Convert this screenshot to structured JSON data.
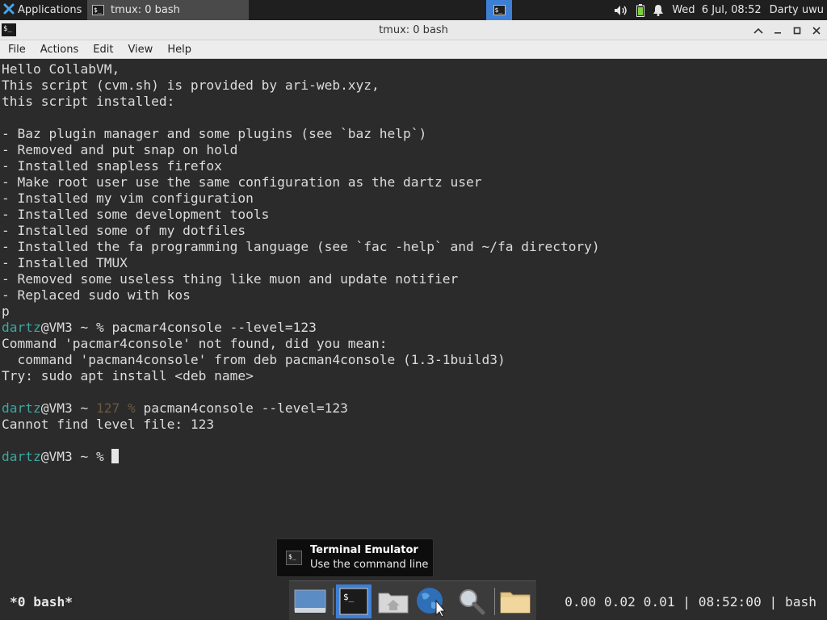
{
  "top_panel": {
    "apps_label": "Applications",
    "task_label": "tmux: 0 bash",
    "clock": "Wed  6 Jul, 08:52",
    "user": "Darty uwu"
  },
  "window": {
    "title": "tmux: 0 bash"
  },
  "menubar": {
    "items": [
      "File",
      "Actions",
      "Edit",
      "View",
      "Help"
    ]
  },
  "terminal": {
    "lines": [
      "Hello CollabVM,",
      "This script (cvm.sh) is provided by ari-web.xyz,",
      "this script installed:",
      "",
      "- Baz plugin manager and some plugins (see `baz help`)",
      "- Removed and put snap on hold",
      "- Installed snapless firefox",
      "- Make root user use the same configuration as the dartz user",
      "- Installed my vim configuration",
      "- Installed some development tools",
      "- Installed some of my dotfiles",
      "- Installed the fa programming language (see `fac -help` and ~/fa directory)",
      "- Installed TMUX",
      "- Removed some useless thing like muon and update notifier",
      "- Replaced sudo with kos",
      "p"
    ],
    "prompt1": {
      "user": "dartz",
      "host": "@VM3 ~ % ",
      "command": "pacmar4console --level=123"
    },
    "output1": [
      "Command 'pacmar4console' not found, did you mean:",
      "  command 'pacman4console' from deb pacman4console (1.3-1build3)",
      "Try: sudo apt install <deb name>",
      ""
    ],
    "prompt2": {
      "user": "dartz",
      "host": "@VM3 ~ ",
      "status": "127 % ",
      "command": "pacman4console --level=123"
    },
    "output2": [
      "Cannot find level file: 123",
      ""
    ],
    "prompt3": {
      "user": "dartz",
      "host": "@VM3 ~ % "
    }
  },
  "tooltip": {
    "title": "Terminal Emulator",
    "subtitle": "Use the command line"
  },
  "tmux_status": {
    "window": "*0 bash*",
    "right": "0.00 0.02 0.01 | 08:52:00 | bash"
  },
  "dock": {
    "icons": [
      "desktop-icon",
      "terminal-icon",
      "home-folder-icon",
      "web-browser-icon",
      "search-icon",
      "folder-icon"
    ]
  },
  "colors": {
    "terminal_bg": "#2b2b2b",
    "prompt_user": "#3aa8a0",
    "error_status": "#6b5a3e",
    "accent": "#3e7fd6"
  }
}
